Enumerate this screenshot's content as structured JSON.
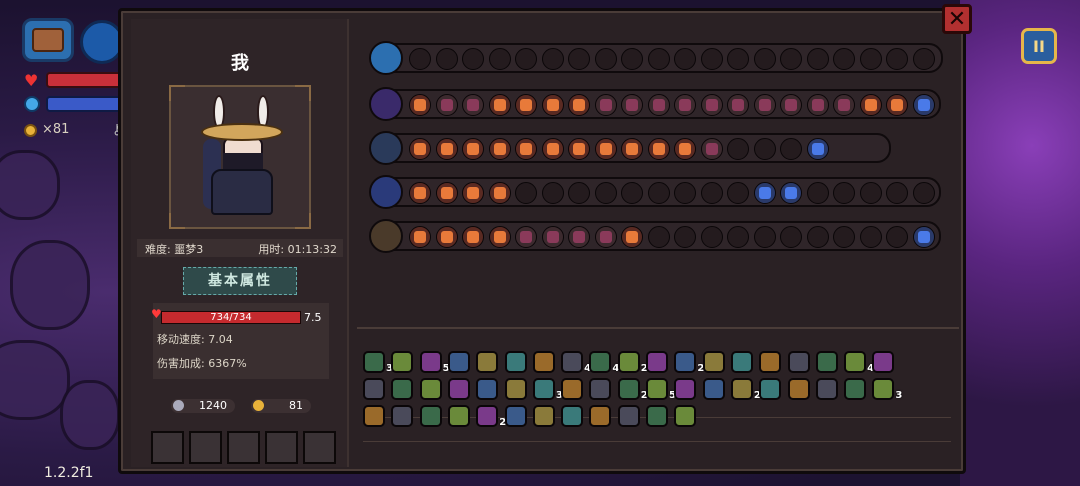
{
  "hud": {
    "coins": "×81"
  },
  "version": "1.2.2f1",
  "pause_label": "II",
  "close_label": "✕",
  "player": {
    "name": "我",
    "difficulty": "难度: 噩梦3",
    "time": "用时: 01:13:32",
    "attr_title": "基本属性",
    "hp": "734/734",
    "hp_side": "7.5",
    "move_speed": "移动速度: 7.04",
    "damage_bonus": "伤害加成: 6367%",
    "keys": "1240",
    "coins": "81"
  },
  "colors": {
    "accent_gold": "#e6b64a",
    "hp_red": "#c52a2e",
    "panel_bg": "#2a2124"
  },
  "weapon_rows": [
    {
      "name": "chest-row",
      "icon": "chest",
      "cells": [
        "e",
        "e",
        "e",
        "e",
        "e",
        "e",
        "e",
        "e",
        "e",
        "e",
        "e",
        "e",
        "e",
        "e",
        "e",
        "e",
        "e",
        "e",
        "e",
        "e"
      ]
    },
    {
      "name": "staff-row-1",
      "icon": "purple-staff",
      "cells": [
        "a",
        "f",
        "f",
        "a",
        "a",
        "a",
        "a",
        "f",
        "f",
        "f",
        "f",
        "f",
        "f",
        "f",
        "f",
        "f",
        "f",
        "a",
        "a",
        "b"
      ]
    },
    {
      "name": "staff-row-2",
      "icon": "ice-staff",
      "cells": [
        "a",
        "a",
        "a",
        "a",
        "a",
        "a",
        "a",
        "a",
        "a",
        "a",
        "a",
        "f",
        "e",
        "e",
        "e",
        "b"
      ]
    },
    {
      "name": "staff-row-3",
      "icon": "blue-staff",
      "cells": [
        "a",
        "a",
        "a",
        "a",
        "e",
        "e",
        "e",
        "e",
        "e",
        "e",
        "e",
        "e",
        "e",
        "b",
        "b",
        "e",
        "e",
        "e",
        "e",
        "e"
      ]
    },
    {
      "name": "staff-row-4",
      "icon": "gold-staff",
      "cells": [
        "a",
        "a",
        "a",
        "a",
        "f",
        "f",
        "f",
        "f",
        "a",
        "e",
        "e",
        "e",
        "e",
        "e",
        "e",
        "e",
        "e",
        "e",
        "e",
        "b"
      ]
    }
  ],
  "inventory": [
    [
      "3",
      "",
      "5",
      "",
      "",
      "",
      "",
      "4",
      "4",
      "2",
      "",
      "2",
      "",
      "",
      "",
      "",
      "",
      "4",
      ""
    ],
    [
      "",
      "",
      "",
      "",
      "",
      "",
      "3",
      "",
      "",
      "2",
      "5",
      "",
      "",
      "2",
      "",
      "",
      "",
      "",
      "3"
    ],
    [
      "",
      "",
      "",
      "",
      "2",
      "",
      "",
      "",
      "",
      "",
      "",
      ""
    ]
  ]
}
